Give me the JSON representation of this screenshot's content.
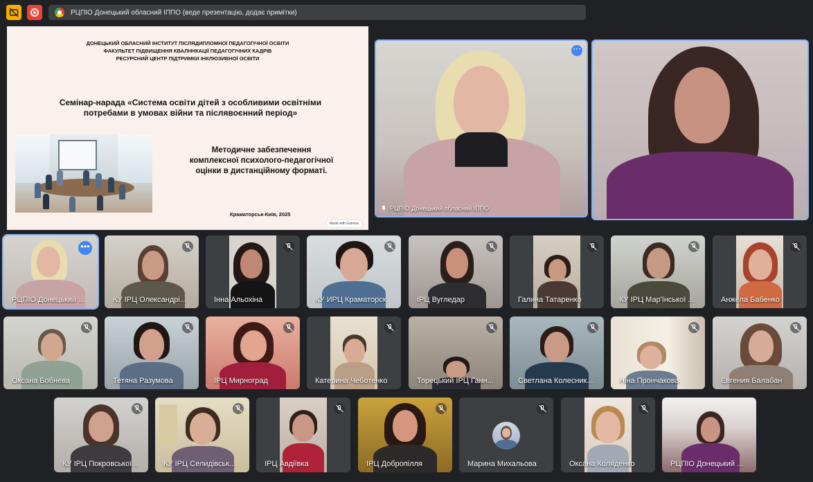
{
  "topbar": {
    "presentation_label": "РЦПІО Донецький обласний ІППО (веде презентацію, додає примітки)",
    "captions_icon": "captions-off-icon",
    "recording_icon": "recording-icon"
  },
  "slide": {
    "header_line1": "ДОНЕЦЬКИЙ ОБЛАСНИЙ ІНСТИТУТ ПІСЛЯДИПЛОМНОЇ ПЕДАГОГІЧНОЇ ОСВІТИ",
    "header_line2": "ФАКУЛЬТЕТ ПІДВИЩЕННЯ КВАЛІФІКАЦІЇ ПЕДАГОГІЧНИХ КАДРІВ",
    "header_line3": "РЕСУРСНИЙ ЦЕНТР ПІДТРИМКИ ІНКЛЮЗИВНОЇ ОСВІТИ",
    "title_line1": "Семінар-нарада «Система освіти дітей з особливими освітніми",
    "title_line2": "потребами в умовах війни та післявоєнний період»",
    "subtitle_line1": "Методичне забезпечення",
    "subtitle_line2": "комплексної психолого-педагогічної",
    "subtitle_line3": "оцінки в дистанційному форматі.",
    "city_year": "Краматорськ-Київ, 2025",
    "gamma_badge": "Made with Gamma"
  },
  "featured": {
    "pinned_label": "РЦПІО Донецький обласний ІППО"
  },
  "participants": {
    "row1": [
      {
        "name": "РЦПІО Донецький ...",
        "muted": false
      },
      {
        "name": "КУ ІРЦ Олександрі...",
        "muted": true
      },
      {
        "name": "Інна Альохіна",
        "muted": true
      },
      {
        "name": "КУ ИРЦ Краматорск",
        "muted": true
      },
      {
        "name": "ІРЦ Вугледар",
        "muted": true
      },
      {
        "name": "Галина Татаренко",
        "muted": true
      },
      {
        "name": "КУ ІРЦ Мар'їнської ...",
        "muted": true
      },
      {
        "name": "Анжела Бабенко",
        "muted": true
      }
    ],
    "row2": [
      {
        "name": "Оксана Бобнева",
        "muted": true
      },
      {
        "name": "Тетяна Разумова",
        "muted": true
      },
      {
        "name": "ІРЦ Мирноград",
        "muted": true
      },
      {
        "name": "Катерина Чеботенко",
        "muted": true
      },
      {
        "name": "Торецький ІРЦ Ганн...",
        "muted": true
      },
      {
        "name": "Светлана Колесник...",
        "muted": true
      },
      {
        "name": "Ніна Прончакова",
        "muted": true
      },
      {
        "name": "Евгения Балабан",
        "muted": true
      }
    ],
    "row3": [
      {
        "name": "КУ ІРЦ Покровської...",
        "muted": true
      },
      {
        "name": "КУ ІРЦ Селидівськ...",
        "muted": true
      },
      {
        "name": "ІРЦ Авдіївка",
        "muted": true
      },
      {
        "name": "ІРЦ Добропілля",
        "muted": true
      },
      {
        "name": "Марина Михальова",
        "muted": true
      },
      {
        "name": "Оксана Коляденко",
        "muted": true
      },
      {
        "name": "РЦПІО Донецький ...",
        "muted": false
      }
    ]
  },
  "colors": {
    "background": "#202124",
    "tile": "#3c4043",
    "accent_blue": "#4285f4",
    "active_border": "#8ab4f8",
    "recording_red": "#ea4335",
    "captions_yellow": "#f9ab00"
  }
}
